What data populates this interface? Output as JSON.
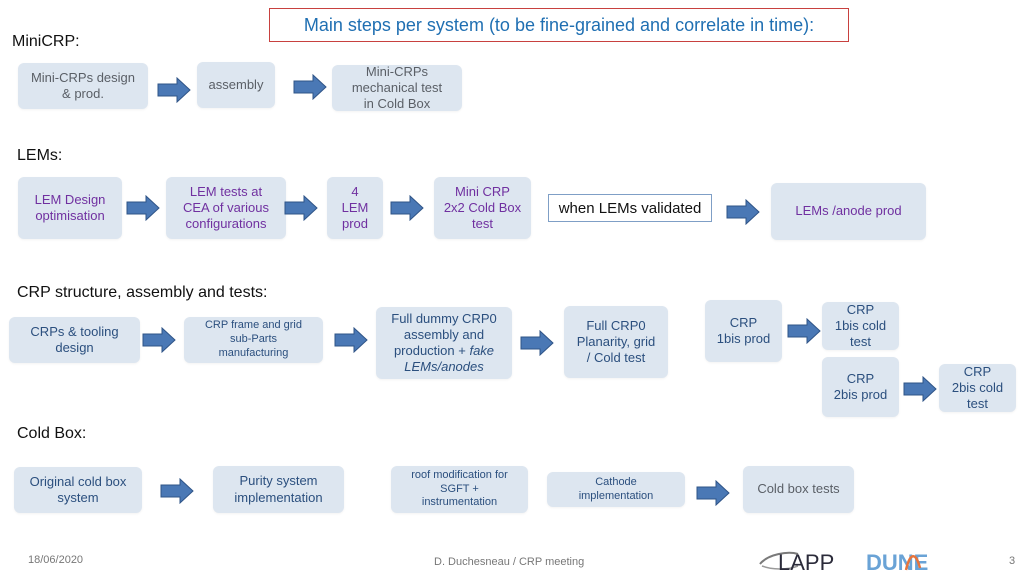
{
  "title": "Main steps per system (to be fine-grained and correlate in time):",
  "colors": {
    "box_fill": "#dde6f0",
    "arrow_fill": "#4a78b5",
    "arrow_stroke": "#2f5487",
    "title_text": "#1f6fb2",
    "title_border": "#c8413f",
    "purple_text": "#7030a0"
  },
  "sections": {
    "minicrp": {
      "label": "MiniCRP:",
      "steps": [
        {
          "lines": [
            "Mini-CRPs design",
            "& prod."
          ]
        },
        {
          "lines": [
            "assembly"
          ]
        },
        {
          "lines": [
            "Mini-CRPs",
            "mechanical test",
            "in Cold Box"
          ]
        }
      ]
    },
    "lems": {
      "label": "LEMs:",
      "steps": [
        {
          "lines": [
            "LEM Design",
            "optimisation"
          ]
        },
        {
          "lines": [
            "LEM tests at",
            "CEA  of various",
            "configurations"
          ]
        },
        {
          "lines": [
            "4",
            "LEM",
            "prod"
          ]
        },
        {
          "lines": [
            "Mini CRP",
            "2x2 Cold Box",
            "test"
          ]
        },
        {
          "lines": [
            "LEMs /anode prod"
          ]
        }
      ],
      "note": "when LEMs validated"
    },
    "crp": {
      "label": "CRP structure, assembly and tests:",
      "steps": [
        {
          "lines": [
            "CRPs & tooling",
            "design"
          ]
        },
        {
          "lines": [
            "CRP frame and grid",
            "sub-Parts",
            "manufacturing"
          ]
        },
        {
          "lines": [
            "Full dummy CRP0",
            "assembly and",
            "production + ",
            "fake",
            "LEMs/anodes"
          ]
        },
        {
          "lines": [
            "Full CRP0",
            "Planarity, grid",
            "/ Cold test"
          ]
        },
        {
          "lines": [
            "CRP",
            "1bis prod"
          ]
        },
        {
          "lines": [
            "CRP",
            "1bis cold",
            "test"
          ]
        },
        {
          "lines": [
            "CRP",
            "2bis prod"
          ]
        },
        {
          "lines": [
            "CRP",
            "2bis cold",
            "test"
          ]
        }
      ]
    },
    "coldbox": {
      "label": "Cold Box:",
      "steps": [
        {
          "lines": [
            "Original cold box",
            "system"
          ]
        },
        {
          "lines": [
            "Purity system",
            "implementation"
          ]
        },
        {
          "lines": [
            "roof modification for",
            "SGFT +",
            "instrumentation"
          ]
        },
        {
          "lines": [
            "Cathode",
            "implementation"
          ]
        },
        {
          "lines": [
            "Cold box  tests"
          ]
        }
      ]
    }
  },
  "footer": {
    "date": "18/06/2020",
    "author": "D. Duchesneau / CRP meeting",
    "page": "3",
    "logos": [
      "LAPP",
      "DUNE"
    ]
  }
}
